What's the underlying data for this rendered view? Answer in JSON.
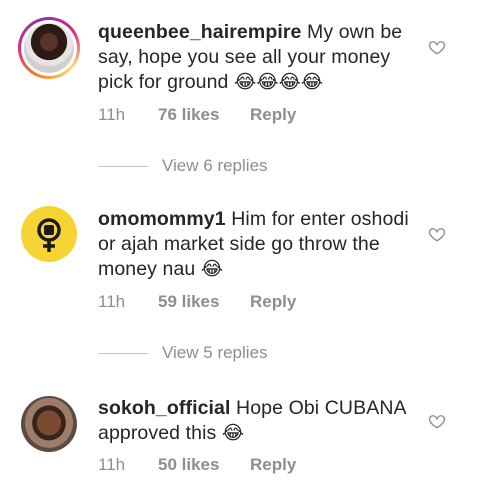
{
  "comments": [
    {
      "username": "queenbee_hairempire",
      "text": "My own be say, hope you see all your money pick for ground",
      "emojis": "😂😂😂😂",
      "time": "11h",
      "likes": "76 likes",
      "reply": "Reply",
      "avatar": "profile-photo-with-story-ring"
    },
    {
      "username": "omomommy1",
      "text": "Him for enter oshodi or ajah market side go throw the money nau",
      "emojis": "😂",
      "time": "11h",
      "likes": "59 likes",
      "reply": "Reply",
      "avatar": "yellow-female-fist-symbol"
    },
    {
      "username": "sokoh_official",
      "text": "Hope Obi CUBANA approved this",
      "emojis": "😂",
      "time": "11h",
      "likes": "50 likes",
      "reply": "Reply",
      "avatar": "profile-photo-man"
    }
  ],
  "view_replies": [
    "View 6 replies",
    "View 5 replies"
  ],
  "colors": {
    "text": "#262626",
    "meta": "#8e8e8e",
    "divider": "#c7c7c7",
    "avatar_yellow": "#f6d436"
  },
  "icons": {
    "like": "heart-outline-icon"
  }
}
